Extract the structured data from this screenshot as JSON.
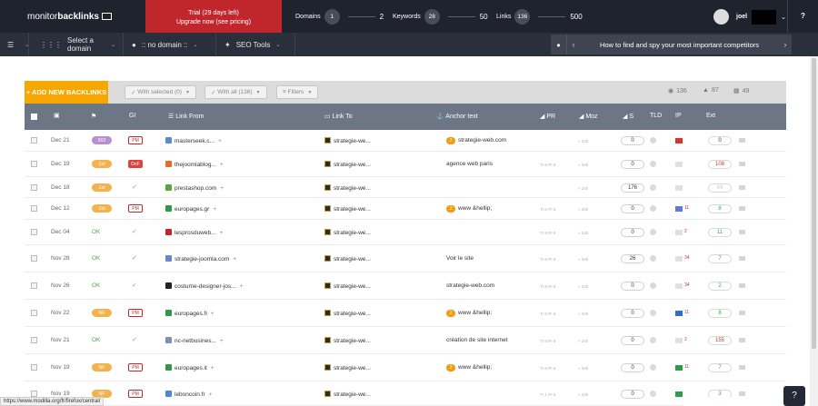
{
  "header": {
    "logo_light": "monitor",
    "logo_bold": "backlinks",
    "trial_line1": "Trial (29 days left)",
    "trial_line2": "Upgrade now (see pricing)",
    "domains_label": "Domains",
    "domains_count": "1",
    "domains_max": "2",
    "keywords_label": "Keywords",
    "keywords_count": "28",
    "keywords_max": "50",
    "links_label": "Links",
    "links_count": "136",
    "links_max": "500",
    "username": "joel",
    "help": "?"
  },
  "nav": {
    "select_domain": "Select a domain",
    "no_domain": ":: no domain ::",
    "seo_tools": "SEO Tools",
    "tip": "How to find and spy your most important competitors"
  },
  "toolbar": {
    "add_button": "+ ADD NEW BACKLINKS",
    "with_selected": "With selected (0)",
    "with_all": "With all (136)",
    "filters": "Filters",
    "count_views": "136",
    "count_likes": "87",
    "count_broken": "49"
  },
  "table": {
    "headers": {
      "gi": "GI",
      "link_from": "Link From",
      "link_to": "Link To",
      "anchor": "Anchor text",
      "pr": "PR",
      "moz": "Moz",
      "s": "S",
      "tld": "TLD",
      "ip": "IP",
      "ext": "Ext"
    },
    "rows": [
      {
        "date": "Dec 21",
        "status": "302",
        "gi": "PM",
        "from": "masterseek.c...",
        "to": "strategie-we...",
        "anchor": "strategie-web.com",
        "anchor_badge": "2",
        "pr": "",
        "moz": "≈ 24h",
        "s": "0",
        "ip_count": "",
        "ext": "0",
        "ext_color": "#333333"
      },
      {
        "date": "Dec 19",
        "status": "1st",
        "gi": "DnF",
        "from": "thejoomlablog...",
        "to": "strategie-we...",
        "anchor": "agence web paris",
        "anchor_badge": "",
        "pr": "Tr 8 Pr 8",
        "moz": "≈ 24h",
        "s": "0",
        "ip_count": "",
        "ext": "108",
        "ext_color": "#c0392b"
      },
      {
        "date": "Dec 18",
        "status": "1st",
        "gi": "",
        "from": "prestashop.com",
        "to": "strategie-we...",
        "anchor": "",
        "anchor_badge": "",
        "pr": "",
        "moz": "≈ 24h",
        "s": "176",
        "ip_count": "",
        "ext": "69",
        "ext_color": "#cccccc"
      },
      {
        "date": "Dec 12",
        "status": "1st",
        "gi": "PM",
        "from": "europages.gr",
        "to": "strategie-we...",
        "anchor": "www &hellip;",
        "anchor_badge": "2",
        "pr": "Tr 6 Pr 6",
        "moz": "≈ 24h",
        "s": "0",
        "ip_count": "11",
        "ext": "8",
        "ext_color": "#27ae60"
      },
      {
        "date": "Dec 04",
        "status": "OK",
        "gi": "",
        "from": "lesprosduweb...",
        "to": "strategie-we...",
        "anchor": "",
        "anchor_badge": "",
        "pr": "Tr 8 Pr 8",
        "moz": "≈ 24h",
        "s": "0",
        "ip_count": "2",
        "ext": "11",
        "ext_color": "#27ae60"
      },
      {
        "date": "Nov 28",
        "status": "OK",
        "gi": "",
        "from": "strategie-joomla.com",
        "to": "strategie-we...",
        "anchor": "Voir le site",
        "anchor_badge": "",
        "pr": "Tr 8 Pr 8",
        "moz": "≈ 24h",
        "s": "26",
        "ip_count": "34",
        "ext": "7",
        "ext_color": "#27ae60"
      },
      {
        "date": "Nov 26",
        "status": "OK",
        "gi": "",
        "from": "costume-designer-jos...",
        "to": "strategie-we...",
        "anchor": "strategie-web.com",
        "anchor_badge": "",
        "pr": "Tr 8 Pr 8",
        "moz": "≈ 24h",
        "s": "0",
        "ip_count": "34",
        "ext": "2",
        "ext_color": "#27ae60"
      },
      {
        "date": "Nov 22",
        "status": "NF",
        "gi": "PM",
        "from": "europages.fi",
        "to": "strategie-we...",
        "anchor": "www &hellip;",
        "anchor_badge": "2",
        "pr": "Tr 6 Pr 6",
        "moz": "≈ 24h",
        "s": "0",
        "ip_count": "11",
        "ext": "8",
        "ext_color": "#27ae60"
      },
      {
        "date": "Nov 21",
        "status": "OK",
        "gi": "",
        "from": "nc-netbusines...",
        "to": "strategie-we...",
        "anchor": "création de site internet",
        "anchor_badge": "",
        "pr": "Tr 8 Pr 8",
        "moz": "≈ 24h",
        "s": "0",
        "ip_count": "2",
        "ext": "155",
        "ext_color": "#c0392b"
      },
      {
        "date": "Nov 19",
        "status": "NF",
        "gi": "PM",
        "from": "europages.it",
        "to": "strategie-we...",
        "anchor": "www &hellip;",
        "anchor_badge": "2",
        "pr": "Tr 6 Pr 6",
        "moz": "≈ 24h",
        "s": "0",
        "ip_count": "11",
        "ext": "7",
        "ext_color": "#27ae60"
      },
      {
        "date": "Nov 19",
        "status": "NF",
        "gi": "PM",
        "from": "leboncoin.fr",
        "to": "strategie-we...",
        "anchor": "",
        "anchor_badge": "",
        "pr": "Tr 1 Pr 6",
        "moz": "≈ 24h",
        "s": "0",
        "ip_count": "",
        "ext": "3",
        "ext_color": "#27ae60"
      }
    ]
  },
  "status_url": "https://www.modilla.org/fr/firefox/central/",
  "colors": {
    "topbar": "#1e232d",
    "trial": "#c0272d",
    "accent_orange": "#f6a800",
    "table_header": "#6d7684",
    "status_302": "#b68fd0",
    "status_1st": "#f4b24c",
    "ok_green": "#49a949"
  }
}
